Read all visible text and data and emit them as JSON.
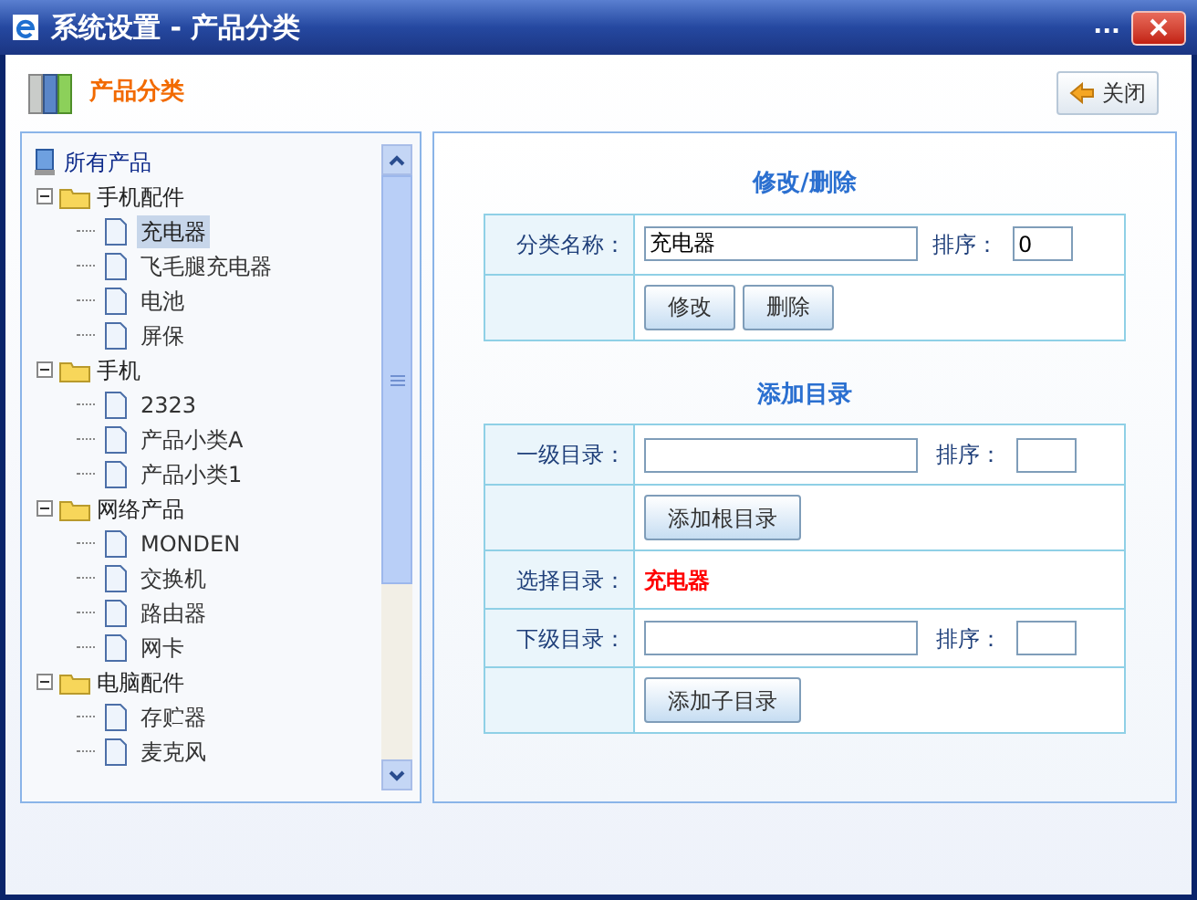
{
  "window": {
    "title": "系统设置 - 产品分类",
    "menu_glyph": "..."
  },
  "header": {
    "title": "产品分类",
    "close_button": "关闭"
  },
  "tree": {
    "root": "所有产品",
    "groups": [
      {
        "label": "手机配件",
        "expanded": true,
        "children": [
          {
            "label": "充电器",
            "selected": true
          },
          {
            "label": "飞毛腿充电器",
            "selected": false
          },
          {
            "label": "电池",
            "selected": false
          },
          {
            "label": "屏保",
            "selected": false
          }
        ]
      },
      {
        "label": "手机",
        "expanded": true,
        "children": [
          {
            "label": "2323",
            "selected": false
          },
          {
            "label": "产品小类A",
            "selected": false
          },
          {
            "label": "产品小类1",
            "selected": false
          }
        ]
      },
      {
        "label": "网络产品",
        "expanded": true,
        "children": [
          {
            "label": "MONDEN",
            "selected": false
          },
          {
            "label": "交换机",
            "selected": false
          },
          {
            "label": "路由器",
            "selected": false
          },
          {
            "label": "网卡",
            "selected": false
          }
        ]
      },
      {
        "label": "电脑配件",
        "expanded": true,
        "children": [
          {
            "label": "存贮器",
            "selected": false
          },
          {
            "label": "麦克风",
            "selected": false
          }
        ]
      }
    ]
  },
  "edit_section": {
    "title": "修改/删除",
    "name_label": "分类名称：",
    "name_value": "充电器",
    "order_label": "排序：",
    "order_value": "0",
    "buttons": [
      "修改",
      "删除"
    ]
  },
  "add_section": {
    "title": "添加目录",
    "rows": [
      {
        "kind": "input",
        "label": "一级目录：",
        "order_label": "排序："
      },
      {
        "kind": "button",
        "button": "添加根目录"
      },
      {
        "kind": "selected",
        "label": "选择目录：",
        "value": "充电器"
      },
      {
        "kind": "input",
        "label": "下级目录：",
        "order_label": "排序："
      },
      {
        "kind": "button",
        "button": "添加子目录"
      }
    ]
  }
}
